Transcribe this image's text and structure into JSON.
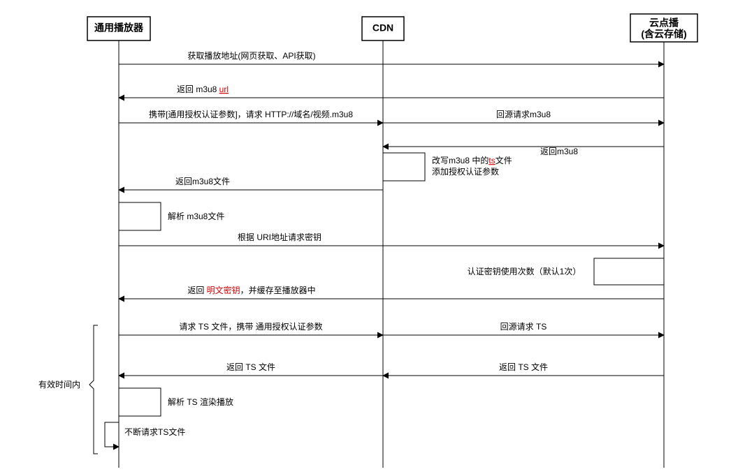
{
  "actors": {
    "player": "通用播放器",
    "cdn": "CDN",
    "vod1": "云点播",
    "vod2": "(含云存储)"
  },
  "msgs": {
    "m1": "获取播放地址(网页获取、API获取)",
    "m2a": "返回 m3u8 ",
    "m2b": "url",
    "m3": "携带[通用授权认证参数]，请求 HTTP://域名/视频.m3u8",
    "m4": "回源请求m3u8",
    "m5": "返回m3u8",
    "m6a": "改写m3u8 中的",
    "m6b": "ts",
    "m6c": "文件",
    "m6d": "添加授权认证参数",
    "m7": "返回m3u8文件",
    "m8": "解析 m3u8文件",
    "m9": "根据 URI地址请求密钥",
    "m10": "认证密钥使用次数（默认1次）",
    "m11a": "返回 ",
    "m11b": "明文密钥",
    "m11c": "，并缓存至播放器中",
    "m12": "请求 TS 文件，携带 通用授权认证参数",
    "m13": "回源请求 TS",
    "m14": "返回 TS 文件",
    "m15": "返回 TS 文件",
    "m16": "解析 TS 渲染播放",
    "m17": "不断请求TS文件"
  },
  "group": "有效时间内"
}
